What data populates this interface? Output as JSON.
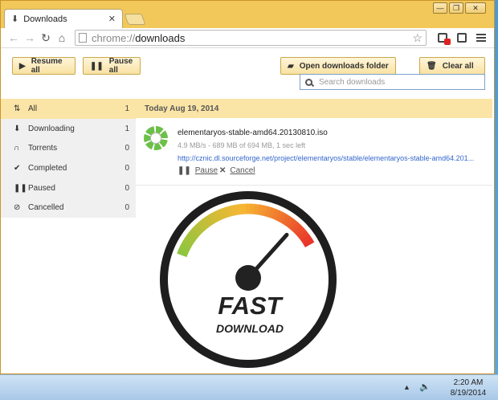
{
  "tab": {
    "icon": "download-icon",
    "title": "Downloads",
    "close": "✕"
  },
  "window_controls": {
    "minimize": "—",
    "maximize": "❐",
    "close": "✕"
  },
  "omnibox": {
    "scheme": "chrome://",
    "path": "downloads"
  },
  "buttons": {
    "resume_all": "Resume all",
    "pause_all": "Pause all",
    "open_folder": "Open downloads folder",
    "clear_all": "Clear all"
  },
  "search": {
    "placeholder": "Search downloads"
  },
  "sidebar": {
    "items": [
      {
        "label": "All",
        "count": "1",
        "icon": "sort-icon",
        "glyph": "⇅"
      },
      {
        "label": "Downloading",
        "count": "1",
        "icon": "download-arrow-icon",
        "glyph": "⬇"
      },
      {
        "label": "Torrents",
        "count": "0",
        "icon": "magnet-icon",
        "glyph": "∩"
      },
      {
        "label": "Completed",
        "count": "0",
        "icon": "checkmark-icon",
        "glyph": "✔"
      },
      {
        "label": "Paused",
        "count": "0",
        "icon": "pause-icon",
        "glyph": "❚❚"
      },
      {
        "label": "Cancelled",
        "count": "0",
        "icon": "cancel-icon",
        "glyph": "⊘"
      }
    ]
  },
  "date_header": "Today Aug 19, 2014",
  "download": {
    "filename": "elementaryos-stable-amd64.20130810.iso",
    "status": "4.9 MB/s - 689 MB of 694 MB, 1 sec left",
    "url": "http://cznic.dl.sourceforge.net/project/elementaryos/stable/elementaryos-stable-amd64.201...",
    "pause_label": "Pause",
    "cancel_label": "Cancel"
  },
  "gauge": {
    "line1": "FAST",
    "line2": "DOWNLOAD",
    "level": 0.86,
    "colors": {
      "low": "#8cc63f",
      "mid": "#f7b733",
      "high": "#e8332a"
    }
  },
  "taskbar": {
    "time": "2:20 AM",
    "date": "8/19/2014"
  },
  "colors": {
    "accent": "#f2c85a",
    "highlight": "#fbe5a6",
    "link": "#3366cc"
  }
}
